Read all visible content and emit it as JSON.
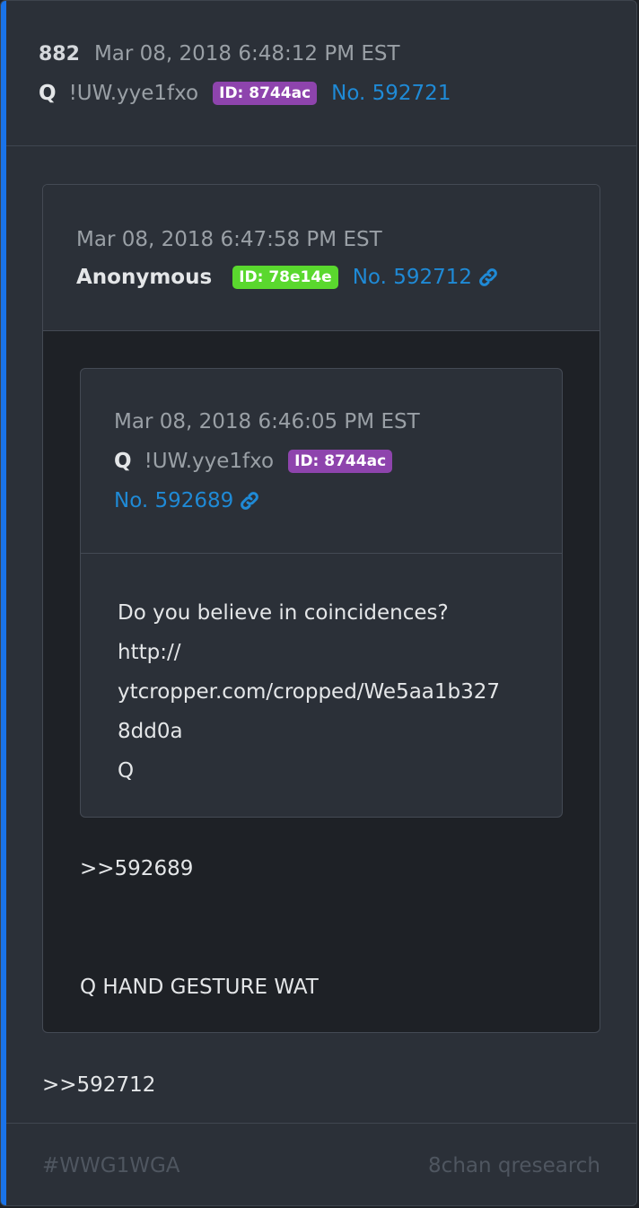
{
  "post": {
    "number": "882",
    "date": "Mar 08, 2018 6:48:12 PM EST",
    "author": "Q",
    "tripcode": "!UW.yye1fxo",
    "id_badge": "ID: 8744ac",
    "post_no": "No. 592721",
    "reply_text": ">>592712"
  },
  "quote1": {
    "date": "Mar 08, 2018 6:47:58 PM EST",
    "author": "Anonymous",
    "id_badge": "ID: 78e14e",
    "post_no": "No. 592712",
    "reply_ref": ">>592689",
    "text": "Q HAND GESTURE WAT"
  },
  "quote2": {
    "date": "Mar 08, 2018 6:46:05 PM EST",
    "author": "Q",
    "tripcode": "!UW.yye1fxo",
    "id_badge": "ID: 8744ac",
    "post_no": "No. 592689",
    "lines": [
      "Do you believe in coincidences?",
      "http://",
      "ytcropper.com/cropped/We5aa1b327",
      "8dd0a",
      "Q"
    ]
  },
  "footer": {
    "hashtag": "#WWG1WGA",
    "source": "8chan qresearch"
  },
  "colors": {
    "accent": "#1a73e8",
    "link": "#1f8ad6",
    "badge_purple": "#8e44ad",
    "badge_green": "#5ad82e"
  }
}
